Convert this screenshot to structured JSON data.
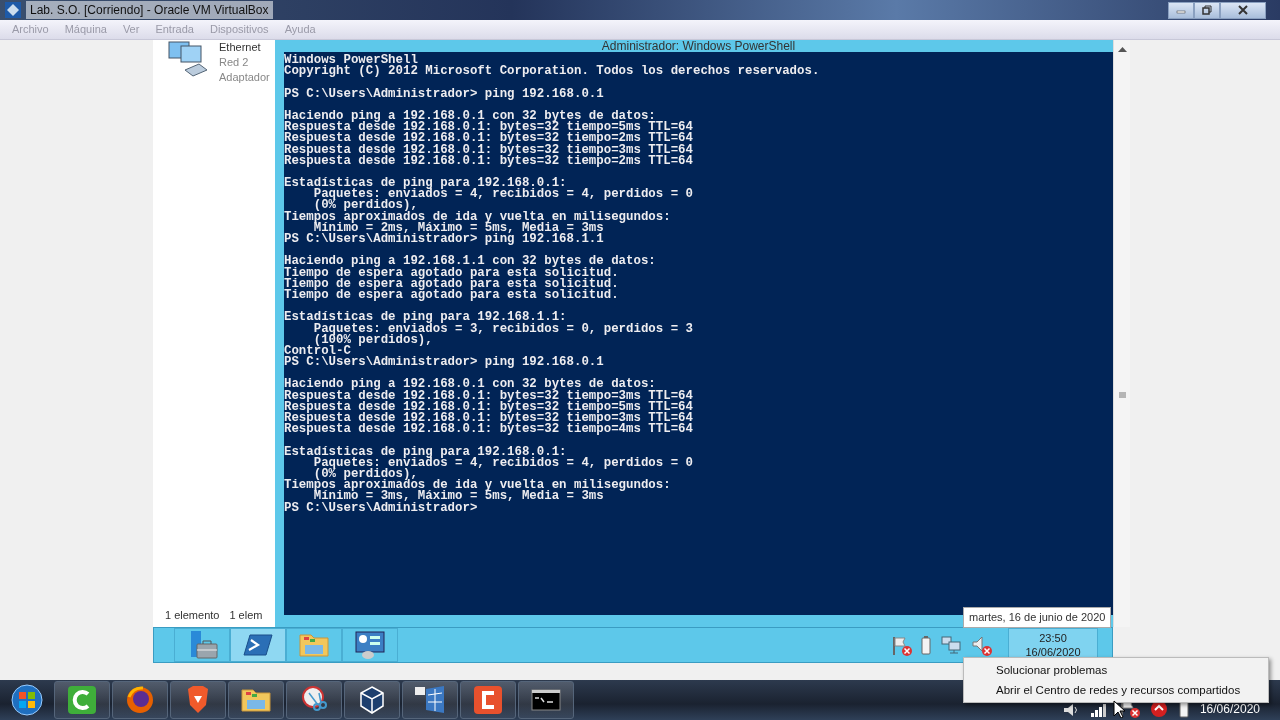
{
  "host_window": {
    "title": "Lab. S.O. [Corriendo] - Oracle VM VirtualBox",
    "menu": [
      "Archivo",
      "Máquina",
      "Ver",
      "Entrada",
      "Dispositivos",
      "Ayuda"
    ]
  },
  "explorer": {
    "item": {
      "name": "Ethernet",
      "lines": [
        "Red 2",
        "Adaptador"
      ]
    },
    "status": [
      "1 elemento",
      "1 elem"
    ]
  },
  "powershell": {
    "title": "Administrador: Windows PowerShell",
    "blocks": [
      [
        "Windows PowerShell",
        "Copyright (C) 2012 Microsoft Corporation. Todos los derechos reservados."
      ],
      [
        "PS C:\\Users\\Administrador> ping 192.168.0.1"
      ],
      [
        "Haciendo ping a 192.168.0.1 con 32 bytes de datos:",
        "Respuesta desde 192.168.0.1: bytes=32 tiempo=5ms TTL=64",
        "Respuesta desde 192.168.0.1: bytes=32 tiempo=2ms TTL=64",
        "Respuesta desde 192.168.0.1: bytes=32 tiempo=3ms TTL=64",
        "Respuesta desde 192.168.0.1: bytes=32 tiempo=2ms TTL=64"
      ],
      [
        "Estadísticas de ping para 192.168.0.1:",
        "    Paquetes: enviados = 4, recibidos = 4, perdidos = 0",
        "    (0% perdidos),",
        "Tiempos aproximados de ida y vuelta en milisegundos:",
        "    Mínimo = 2ms, Máximo = 5ms, Media = 3ms",
        "PS C:\\Users\\Administrador> ping 192.168.1.1"
      ],
      [
        "Haciendo ping a 192.168.1.1 con 32 bytes de datos:",
        "Tiempo de espera agotado para esta solicitud.",
        "Tiempo de espera agotado para esta solicitud.",
        "Tiempo de espera agotado para esta solicitud."
      ],
      [
        "Estadísticas de ping para 192.168.1.1:",
        "    Paquetes: enviados = 3, recibidos = 0, perdidos = 3",
        "    (100% perdidos),",
        "Control-C",
        "PS C:\\Users\\Administrador> ping 192.168.0.1"
      ],
      [
        "Haciendo ping a 192.168.0.1 con 32 bytes de datos:",
        "Respuesta desde 192.168.0.1: bytes=32 tiempo=3ms TTL=64",
        "Respuesta desde 192.168.0.1: bytes=32 tiempo=5ms TTL=64",
        "Respuesta desde 192.168.0.1: bytes=32 tiempo=3ms TTL=64",
        "Respuesta desde 192.168.0.1: bytes=32 tiempo=4ms TTL=64"
      ],
      [
        "Estadísticas de ping para 192.168.0.1:",
        "    Paquetes: enviados = 4, recibidos = 4, perdidos = 0",
        "    (0% perdidos),",
        "Tiempos aproximados de ida y vuelta en milisegundos:",
        "    Mínimo = 3ms, Máximo = 5ms, Media = 3ms",
        "PS C:\\Users\\Administrador>"
      ]
    ]
  },
  "guest_taskbar": {
    "apps": [
      {
        "kind": "server",
        "selected": false
      },
      {
        "kind": "powershell",
        "selected": true
      },
      {
        "kind": "folder",
        "selected": false
      },
      {
        "kind": "panel",
        "selected": false
      }
    ],
    "tray": [
      {
        "kind": "flag"
      },
      {
        "kind": "battery"
      },
      {
        "kind": "network"
      },
      {
        "kind": "speaker"
      }
    ],
    "clock": {
      "time": "23:50",
      "date": "16/06/2020"
    }
  },
  "tooltip": "martes, 16 de junio de 2020",
  "context_menu": [
    "Solucionar problemas",
    "Abrir el Centro de redes y recursos compartidos"
  ],
  "host_taskbar": {
    "apps": [
      {
        "kind": "camtasia-green"
      },
      {
        "kind": "firefox"
      },
      {
        "kind": "brave"
      },
      {
        "kind": "folder"
      },
      {
        "kind": "scissors"
      },
      {
        "kind": "cube"
      },
      {
        "kind": "win7"
      },
      {
        "kind": "camtasia-red"
      },
      {
        "kind": "terminal"
      }
    ],
    "tray": [
      {
        "kind": "speaker"
      },
      {
        "kind": "network"
      },
      {
        "kind": "flag"
      },
      {
        "kind": "red-dot"
      },
      {
        "kind": "battery"
      }
    ],
    "date": "16/06/2020"
  }
}
